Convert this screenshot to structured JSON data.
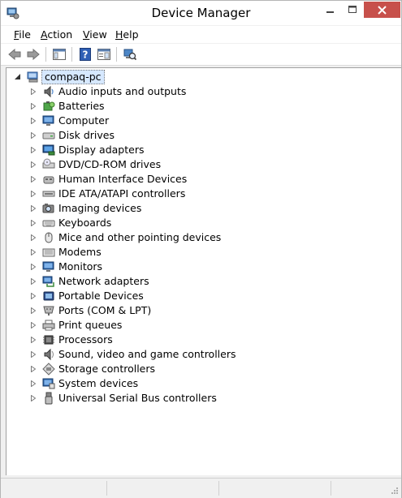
{
  "window": {
    "title": "Device Manager",
    "controls": [
      "minimize-icon",
      "maximize-icon",
      "close-icon"
    ]
  },
  "menu": {
    "file": {
      "underlined": "F",
      "rest": "ile"
    },
    "action": {
      "underlined": "A",
      "rest": "ction"
    },
    "view": {
      "underlined": "V",
      "rest": "iew"
    },
    "help": {
      "underlined": "H",
      "rest": "elp"
    }
  },
  "toolbar": {
    "buttons": [
      "back-icon",
      "forward-icon",
      "show-hide-console-tree-icon",
      "help-icon",
      "properties-icon",
      "scan-hardware-icon"
    ]
  },
  "tree": {
    "root": {
      "label": "compaq-pc",
      "icon": "computer-icon",
      "expanded": true
    },
    "nodes": [
      {
        "label": "Audio inputs and outputs",
        "icon": "speaker-icon"
      },
      {
        "label": "Batteries",
        "icon": "battery-icon"
      },
      {
        "label": "Computer",
        "icon": "monitor-icon"
      },
      {
        "label": "Disk drives",
        "icon": "disk-drive-icon"
      },
      {
        "label": "Display adapters",
        "icon": "display-adapter-icon"
      },
      {
        "label": "DVD/CD-ROM drives",
        "icon": "optical-drive-icon"
      },
      {
        "label": "Human Interface Devices",
        "icon": "hid-icon"
      },
      {
        "label": "IDE ATA/ATAPI controllers",
        "icon": "ide-controller-icon"
      },
      {
        "label": "Imaging devices",
        "icon": "camera-icon"
      },
      {
        "label": "Keyboards",
        "icon": "keyboard-icon"
      },
      {
        "label": "Mice and other pointing devices",
        "icon": "mouse-icon"
      },
      {
        "label": "Modems",
        "icon": "modem-icon"
      },
      {
        "label": "Monitors",
        "icon": "monitor-icon"
      },
      {
        "label": "Network adapters",
        "icon": "network-adapter-icon"
      },
      {
        "label": "Portable Devices",
        "icon": "portable-device-icon"
      },
      {
        "label": "Ports (COM & LPT)",
        "icon": "port-icon"
      },
      {
        "label": "Print queues",
        "icon": "printer-icon"
      },
      {
        "label": "Processors",
        "icon": "processor-icon"
      },
      {
        "label": "Sound, video and game controllers",
        "icon": "sound-icon"
      },
      {
        "label": "Storage controllers",
        "icon": "storage-controller-icon"
      },
      {
        "label": "System devices",
        "icon": "system-devices-icon"
      },
      {
        "label": "Universal Serial Bus controllers",
        "icon": "usb-icon"
      }
    ]
  },
  "colors": {
    "close_button": "#c7504b",
    "selection": "#d6e8ff"
  }
}
